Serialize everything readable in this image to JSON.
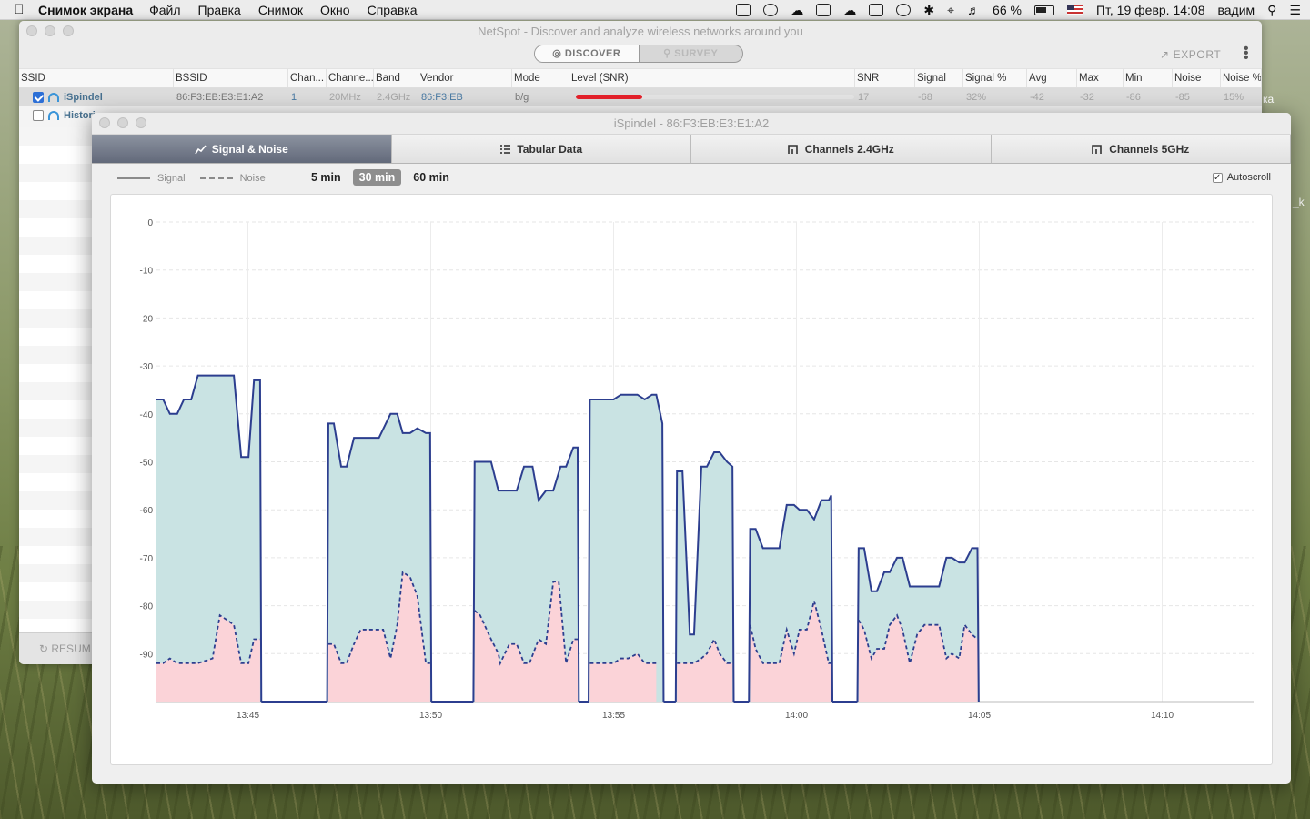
{
  "menubar": {
    "app_name": "Снимок экрана",
    "items": [
      "Файл",
      "Правка",
      "Снимок",
      "Окно",
      "Справка"
    ],
    "battery": "66 %",
    "datetime": "Пт, 19 февр.  14:08",
    "user": "вадим"
  },
  "main_window": {
    "title": "NetSpot - Discover and analyze wireless networks around you",
    "mode_discover": "DISCOVER",
    "mode_survey": "SURVEY",
    "export_label": "EXPORT",
    "resume_label": "RESUM",
    "columns": [
      "SSID",
      "BSSID",
      "Chan...",
      "Channe...",
      "Band",
      "Vendor",
      "Mode",
      "Level (SNR)",
      "SNR",
      "Signal",
      "Signal %",
      "Avg",
      "Max",
      "Min",
      "Noise",
      "Noise %"
    ],
    "rows": [
      {
        "ssid": "iSpindel",
        "bssid": "86:F3:EB:E3:E1:A2",
        "channel": "1",
        "width": "20MHz",
        "band": "2.4GHz",
        "vendor": "86:F3:EB",
        "mode": "b/g",
        "level": 0.24,
        "snr": "17",
        "signal": "-68",
        "signal_pct": "32%",
        "avg": "-42",
        "max": "-32",
        "min": "-86",
        "noise": "-85",
        "noise_pct": "15%",
        "checked": true
      },
      {
        "ssid": "Historia",
        "bssid": "",
        "channel": "",
        "width": "",
        "band": "",
        "vendor": "",
        "mode": "",
        "level": 0,
        "snr": "",
        "signal": "",
        "signal_pct": "",
        "avg": "",
        "max": "",
        "min": "",
        "noise": "",
        "noise_pct": "",
        "checked": false
      }
    ]
  },
  "desktop_peek": [
    "ка",
    "_k"
  ],
  "chart_window": {
    "title": "iSpindel - 86:F3:EB:E3:E1:A2",
    "tabs": [
      "Signal & Noise",
      "Tabular Data",
      "Channels 2.4GHz",
      "Channels 5GHz"
    ],
    "legend_signal": "Signal",
    "legend_noise": "Noise",
    "ranges": [
      "5 min",
      "30 min",
      "60 min"
    ],
    "active_range": "30 min",
    "autoscroll_label": "Autoscroll",
    "autoscroll_checked": true
  },
  "colors": {
    "signal_line": "#2c3e8f",
    "signal_fill": "#c9e3e3",
    "noise_line": "#2c3e8f",
    "noise_fill": "#fbd3d8",
    "active_tab": "#6b7282",
    "level_bar": "#e5212b"
  },
  "chart_data": {
    "type": "area",
    "ylim": [
      -100,
      0
    ],
    "yticks": [
      0,
      -10,
      -20,
      -30,
      -40,
      -50,
      -60,
      -70,
      -80,
      -90
    ],
    "xlim": [
      "13:42:30",
      "14:12:30"
    ],
    "xticks": [
      "13:45",
      "13:50",
      "13:55",
      "14:00",
      "14:05",
      "14:10"
    ],
    "grid": true,
    "series": [
      {
        "name": "Signal",
        "style": "solid",
        "segments": [
          [
            [
              "13:42:30",
              -37
            ],
            [
              "13:42:41",
              -37
            ],
            [
              "13:42:52",
              -40
            ],
            [
              "13:43:04",
              -40
            ],
            [
              "13:43:15",
              -37
            ],
            [
              "13:43:27",
              -37
            ],
            [
              "13:43:38",
              -32
            ],
            [
              "13:44:37",
              -32
            ],
            [
              "13:44:49",
              -49
            ],
            [
              "13:45:01",
              -49
            ],
            [
              "13:45:10",
              -33
            ],
            [
              "13:45:20",
              -33
            ],
            [
              "13:45:22",
              -100
            ]
          ],
          [
            [
              "13:47:10",
              -100
            ],
            [
              "13:47:12",
              -42
            ],
            [
              "13:47:21",
              -42
            ],
            [
              "13:47:33",
              -51
            ],
            [
              "13:47:42",
              -51
            ],
            [
              "13:47:54",
              -45
            ],
            [
              "13:48:05",
              -45
            ],
            [
              "13:48:35",
              -45
            ],
            [
              "13:48:54",
              -40
            ],
            [
              "13:49:05",
              -40
            ],
            [
              "13:49:14",
              -44
            ],
            [
              "13:49:26",
              -44
            ],
            [
              "13:49:38",
              -43
            ],
            [
              "13:49:52",
              -44
            ],
            [
              "13:49:59",
              -44
            ],
            [
              "13:50:01",
              -100
            ]
          ],
          [
            [
              "13:51:10",
              -100
            ],
            [
              "13:51:12",
              -50
            ],
            [
              "13:51:39",
              -50
            ],
            [
              "13:51:51",
              -56
            ],
            [
              "13:52:21",
              -56
            ],
            [
              "13:52:33",
              -51
            ],
            [
              "13:52:47",
              -51
            ],
            [
              "13:52:57",
              -58
            ],
            [
              "13:53:09",
              -56
            ],
            [
              "13:53:21",
              -56
            ],
            [
              "13:53:33",
              -51
            ],
            [
              "13:53:42",
              -51
            ],
            [
              "13:53:54",
              -47
            ],
            [
              "13:54:01",
              -47
            ],
            [
              "13:54:03",
              -100
            ]
          ],
          [
            [
              "13:54:19",
              -100
            ],
            [
              "13:54:21",
              -37
            ],
            [
              "13:55:00",
              -37
            ],
            [
              "13:55:12",
              -36
            ],
            [
              "13:55:39",
              -36
            ],
            [
              "13:55:51",
              -37
            ],
            [
              "13:56:03",
              -36
            ],
            [
              "13:56:10",
              -36
            ],
            [
              "13:56:20",
              -42
            ],
            [
              "13:56:22",
              -100
            ]
          ],
          [
            [
              "13:56:42",
              -100
            ],
            [
              "13:56:44",
              -52
            ],
            [
              "13:56:53",
              -52
            ],
            [
              "13:57:05",
              -86
            ],
            [
              "13:57:12",
              -86
            ],
            [
              "13:57:24",
              -51
            ],
            [
              "13:57:33",
              -51
            ],
            [
              "13:57:45",
              -48
            ],
            [
              "13:57:54",
              -48
            ],
            [
              "13:58:06",
              -50
            ],
            [
              "13:58:15",
              -51
            ],
            [
              "13:58:17",
              -100
            ]
          ],
          [
            [
              "13:58:42",
              -100
            ],
            [
              "13:58:44",
              -64
            ],
            [
              "13:58:53",
              -64
            ],
            [
              "13:59:05",
              -68
            ],
            [
              "13:59:32",
              -68
            ],
            [
              "13:59:44",
              -59
            ],
            [
              "13:59:56",
              -59
            ],
            [
              "14:00:05",
              -60
            ],
            [
              "14:00:17",
              -60
            ],
            [
              "14:00:29",
              -62
            ],
            [
              "14:00:41",
              -58
            ],
            [
              "14:00:53",
              -58
            ],
            [
              "14:00:57",
              -57
            ],
            [
              "14:00:59",
              -100
            ]
          ],
          [
            [
              "14:01:40",
              -100
            ],
            [
              "14:01:42",
              -68
            ],
            [
              "14:01:51",
              -68
            ],
            [
              "14:02:03",
              -77
            ],
            [
              "14:02:12",
              -77
            ],
            [
              "14:02:24",
              -73
            ],
            [
              "14:02:33",
              -73
            ],
            [
              "14:02:45",
              -70
            ],
            [
              "14:02:54",
              -70
            ],
            [
              "14:03:06",
              -76
            ],
            [
              "14:03:54",
              -76
            ],
            [
              "14:04:06",
              -70
            ],
            [
              "14:04:15",
              -70
            ],
            [
              "14:04:27",
              -71
            ],
            [
              "14:04:36",
              -71
            ],
            [
              "14:04:48",
              -68
            ],
            [
              "14:04:57",
              -68
            ],
            [
              "14:04:59",
              -100
            ]
          ]
        ]
      },
      {
        "name": "Noise",
        "style": "dashed",
        "segments": [
          [
            [
              "13:42:30",
              -92
            ],
            [
              "13:42:41",
              -92
            ],
            [
              "13:42:52",
              -91
            ],
            [
              "13:43:04",
              -92
            ],
            [
              "13:43:27",
              -92
            ],
            [
              "13:43:38",
              -92
            ],
            [
              "13:44:02",
              -91
            ],
            [
              "13:44:14",
              -82
            ],
            [
              "13:44:26",
              -83
            ],
            [
              "13:44:37",
              -84
            ],
            [
              "13:44:49",
              -92
            ],
            [
              "13:45:01",
              -92
            ],
            [
              "13:45:10",
              -87
            ],
            [
              "13:45:20",
              -87
            ]
          ],
          [
            [
              "13:47:12",
              -88
            ],
            [
              "13:47:21",
              -88
            ],
            [
              "13:47:33",
              -92
            ],
            [
              "13:47:42",
              -92
            ],
            [
              "13:47:54",
              -88
            ],
            [
              "13:48:05",
              -85
            ],
            [
              "13:48:35",
              -85
            ],
            [
              "13:48:42",
              -85
            ],
            [
              "13:48:54",
              -91
            ],
            [
              "13:49:05",
              -84
            ],
            [
              "13:49:14",
              -73
            ],
            [
              "13:49:26",
              -74
            ],
            [
              "13:49:38",
              -78
            ],
            [
              "13:49:52",
              -92
            ],
            [
              "13:49:59",
              -92
            ]
          ],
          [
            [
              "13:51:12",
              -81
            ],
            [
              "13:51:21",
              -82
            ],
            [
              "13:51:39",
              -87
            ],
            [
              "13:51:51",
              -90
            ],
            [
              "13:51:54",
              -92
            ],
            [
              "13:52:09",
              -88
            ],
            [
              "13:52:21",
              -88
            ],
            [
              "13:52:33",
              -92
            ],
            [
              "13:52:42",
              -92
            ],
            [
              "13:52:57",
              -87
            ],
            [
              "13:53:09",
              -88
            ],
            [
              "13:53:21",
              -75
            ],
            [
              "13:53:30",
              -75
            ],
            [
              "13:53:42",
              -92
            ],
            [
              "13:53:54",
              -87
            ],
            [
              "13:54:01",
              -87
            ]
          ],
          [
            [
              "13:54:21",
              -92
            ],
            [
              "13:55:00",
              -92
            ],
            [
              "13:55:12",
              -91
            ],
            [
              "13:55:24",
              -91
            ],
            [
              "13:55:39",
              -90
            ],
            [
              "13:55:51",
              -92
            ],
            [
              "13:56:03",
              -92
            ],
            [
              "13:56:10",
              -92
            ]
          ],
          [
            [
              "13:56:44",
              -92
            ],
            [
              "13:57:05",
              -92
            ],
            [
              "13:57:12",
              -92
            ],
            [
              "13:57:24",
              -91
            ],
            [
              "13:57:33",
              -90
            ],
            [
              "13:57:45",
              -87
            ],
            [
              "13:57:54",
              -90
            ],
            [
              "13:58:06",
              -92
            ],
            [
              "13:58:15",
              -92
            ]
          ],
          [
            [
              "13:58:44",
              -84
            ],
            [
              "13:58:53",
              -89
            ],
            [
              "13:59:05",
              -92
            ],
            [
              "13:59:32",
              -92
            ],
            [
              "13:59:44",
              -85
            ],
            [
              "13:59:56",
              -90
            ],
            [
              "14:00:05",
              -85
            ],
            [
              "14:00:17",
              -85
            ],
            [
              "14:00:29",
              -79
            ],
            [
              "14:00:41",
              -85
            ],
            [
              "14:00:53",
              -92
            ],
            [
              "14:00:57",
              -92
            ]
          ],
          [
            [
              "14:01:42",
              -83
            ],
            [
              "14:01:51",
              -85
            ],
            [
              "14:02:03",
              -91
            ],
            [
              "14:02:12",
              -89
            ],
            [
              "14:02:24",
              -89
            ],
            [
              "14:02:33",
              -84
            ],
            [
              "14:02:45",
              -82
            ],
            [
              "14:02:54",
              -85
            ],
            [
              "14:03:06",
              -92
            ],
            [
              "14:03:18",
              -86
            ],
            [
              "14:03:30",
              -84
            ],
            [
              "14:03:54",
              -84
            ],
            [
              "14:04:06",
              -91
            ],
            [
              "14:04:15",
              -90
            ],
            [
              "14:04:27",
              -91
            ],
            [
              "14:04:36",
              -84
            ],
            [
              "14:04:48",
              -86
            ],
            [
              "14:04:57",
              -87
            ]
          ]
        ]
      }
    ]
  }
}
